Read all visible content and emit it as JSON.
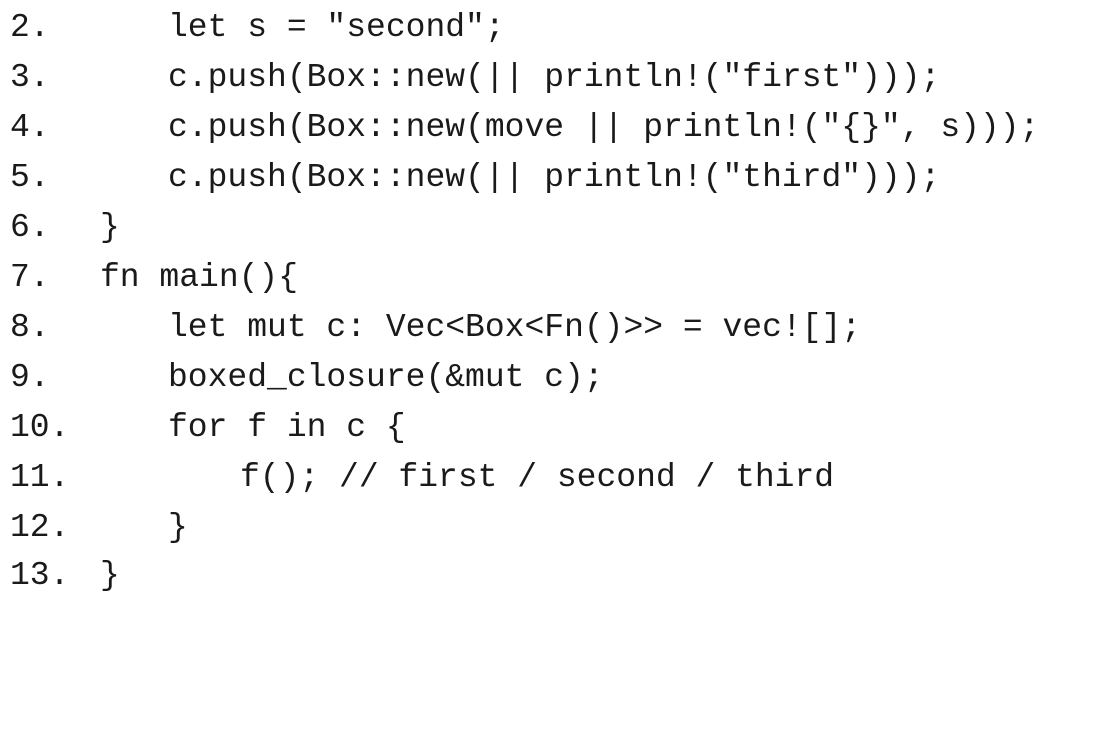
{
  "lines": [
    {
      "number": "2.",
      "code": "let s = \"second\";"
    },
    {
      "number": "3.",
      "code": "c.push(Box::new(|| println!(\"first\")));"
    },
    {
      "number": "4.",
      "code": "c.push(Box::new(move || println!(\"{}\", s)));"
    },
    {
      "number": "5.",
      "code": "c.push(Box::new(|| println!(\"third\")));"
    },
    {
      "number": "6.",
      "code": "}"
    },
    {
      "number": "7.",
      "code": "fn main(){"
    },
    {
      "number": "8.",
      "code": "let mut c: Vec<Box<Fn()>> = vec![];"
    },
    {
      "number": "9.",
      "code": "boxed_closure(&mut c);"
    },
    {
      "number": "10.",
      "code": "for f in c {"
    },
    {
      "number": "11.",
      "code": "f(); // first / second / third"
    },
    {
      "number": "12.",
      "code": "}"
    },
    {
      "number": "13.",
      "code": "}"
    }
  ]
}
